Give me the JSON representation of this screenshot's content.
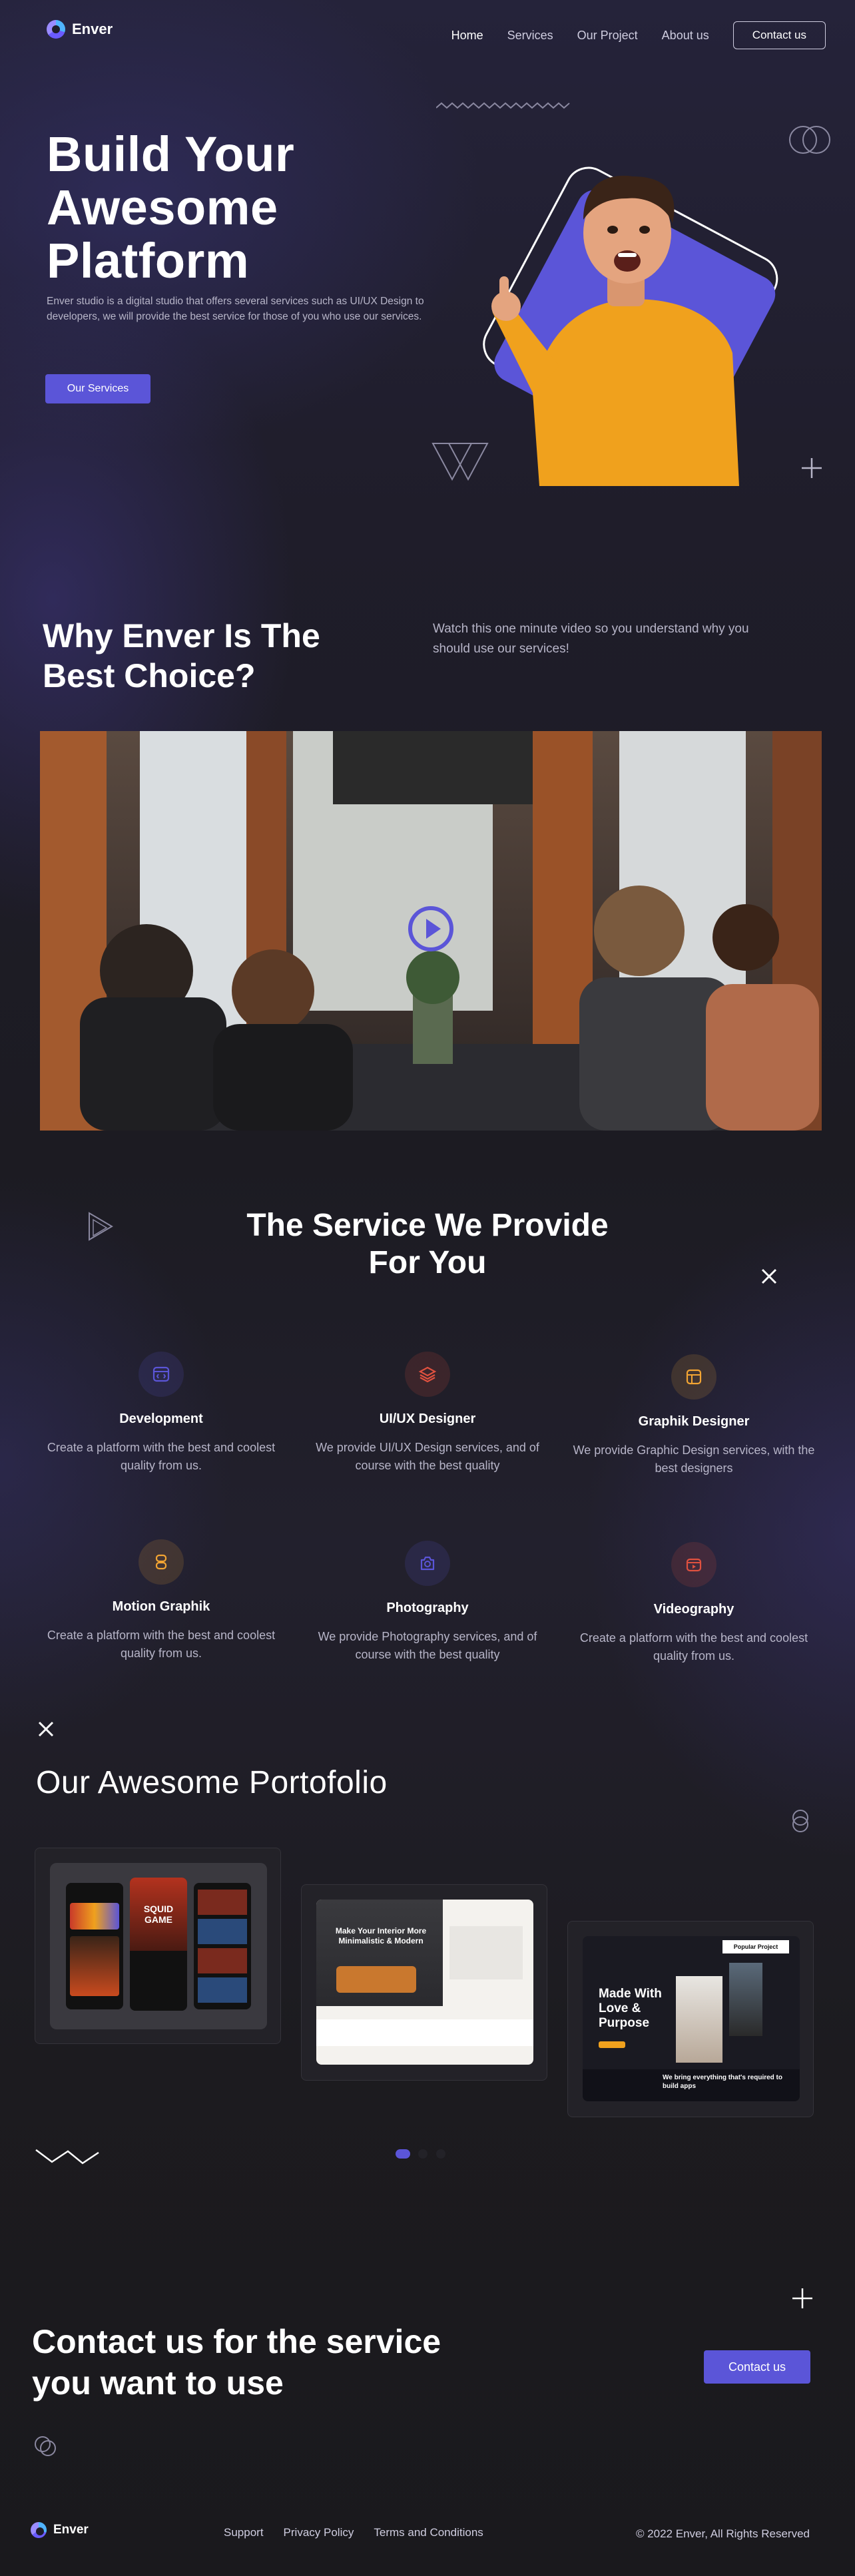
{
  "nav": {
    "brand": "Enver",
    "links": [
      "Home",
      "Services",
      "Our Project",
      "About us"
    ],
    "contact_button": "Contact us"
  },
  "hero": {
    "title_lines": [
      "Build Your",
      "Awesome",
      "Platform"
    ],
    "description": "Enver studio is a digital studio that offers several services such as UI/UX Design to developers, we will provide the best service for those of you who use our services.",
    "cta": "Our Services"
  },
  "why": {
    "title_lines": [
      "Why Enver Is The",
      "Best Choice?"
    ],
    "description": "Watch this one minute video so you understand why you should use our services!"
  },
  "services": {
    "title_lines": [
      "The Service We Provide",
      "For You"
    ],
    "items": [
      {
        "title": "Development",
        "desc": "Create a platform with the best and coolest quality from us.",
        "icon": "code-window-icon",
        "color": "#5b55d8"
      },
      {
        "title": "UI/UX Designer",
        "desc": "We provide UI/UX Design services, and of course with the best quality",
        "icon": "layers-icon",
        "color": "#e0513f"
      },
      {
        "title": "Graphik Designer",
        "desc": "We provide Graphic Design services, with the best designers",
        "icon": "layout-icon",
        "color": "#f3a533"
      },
      {
        "title": "Motion Graphik",
        "desc": "Create a platform with the best and coolest quality from us.",
        "icon": "stack-icon",
        "color": "#f3a533"
      },
      {
        "title": "Photography",
        "desc": "We provide Photography services, and of course with the best quality",
        "icon": "camera-icon",
        "color": "#5b55d8"
      },
      {
        "title": "Videography",
        "desc": "Create a platform with the best and coolest quality from us.",
        "icon": "video-icon",
        "color": "#e0513f"
      }
    ]
  },
  "portfolio": {
    "title": "Our Awesome Portofolio",
    "mockups": {
      "game_title": "SQUID GAME",
      "interior_title": "Make Your Interior More Minimalistic & Modern",
      "purpose_title": "Made With Love & Purpose",
      "purpose_sub": "We bring everything that's required to build apps",
      "popular_label": "Popular Project"
    }
  },
  "contact": {
    "title_lines": [
      "Contact us for the service",
      "you want to use"
    ],
    "button": "Contact us"
  },
  "footer": {
    "brand": "Enver",
    "links": [
      "Support",
      "Privacy Policy",
      "Terms and Conditions"
    ],
    "copyright": "© 2022 Enver, All Rights Reserved"
  },
  "colors": {
    "accent": "#5b55d8",
    "background": "#1b1a1f",
    "hero_shirt": "#f0a11d"
  }
}
